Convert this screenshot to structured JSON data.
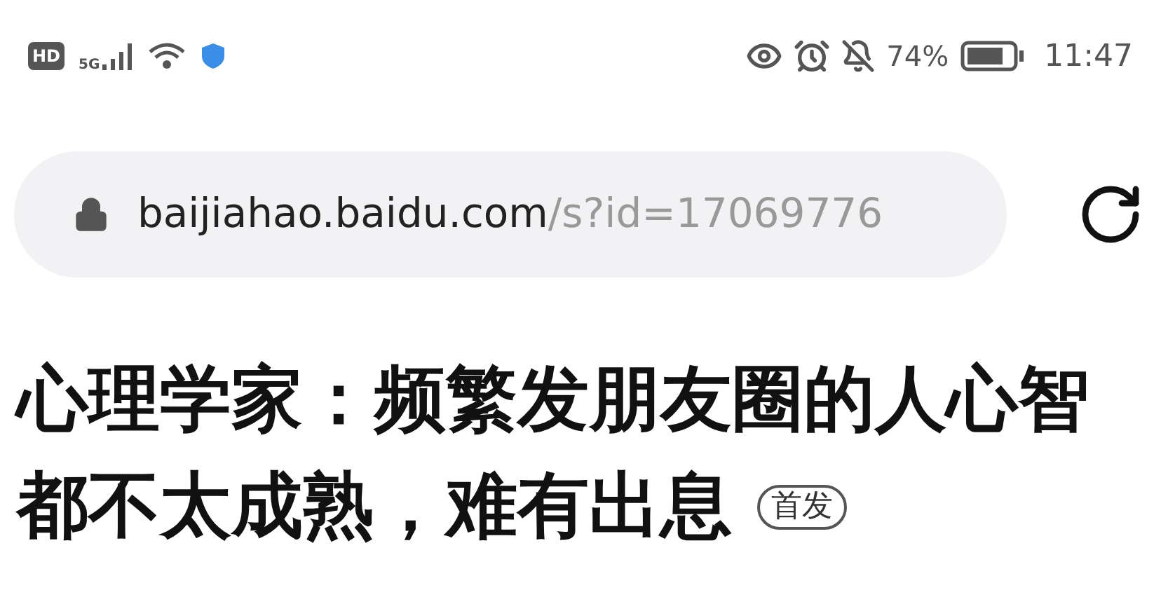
{
  "status_bar": {
    "network_badge": "HD",
    "network_type": "5G",
    "battery_percent": "74%",
    "time": "11:47"
  },
  "address_bar": {
    "host": "baijiahao.baidu.com",
    "path": "/s?id=17069776"
  },
  "article": {
    "title_lines": [
      "心理学家：频繁发朋友圈的人心智",
      "都不太成熟，难有出息"
    ],
    "tag": "首发"
  }
}
